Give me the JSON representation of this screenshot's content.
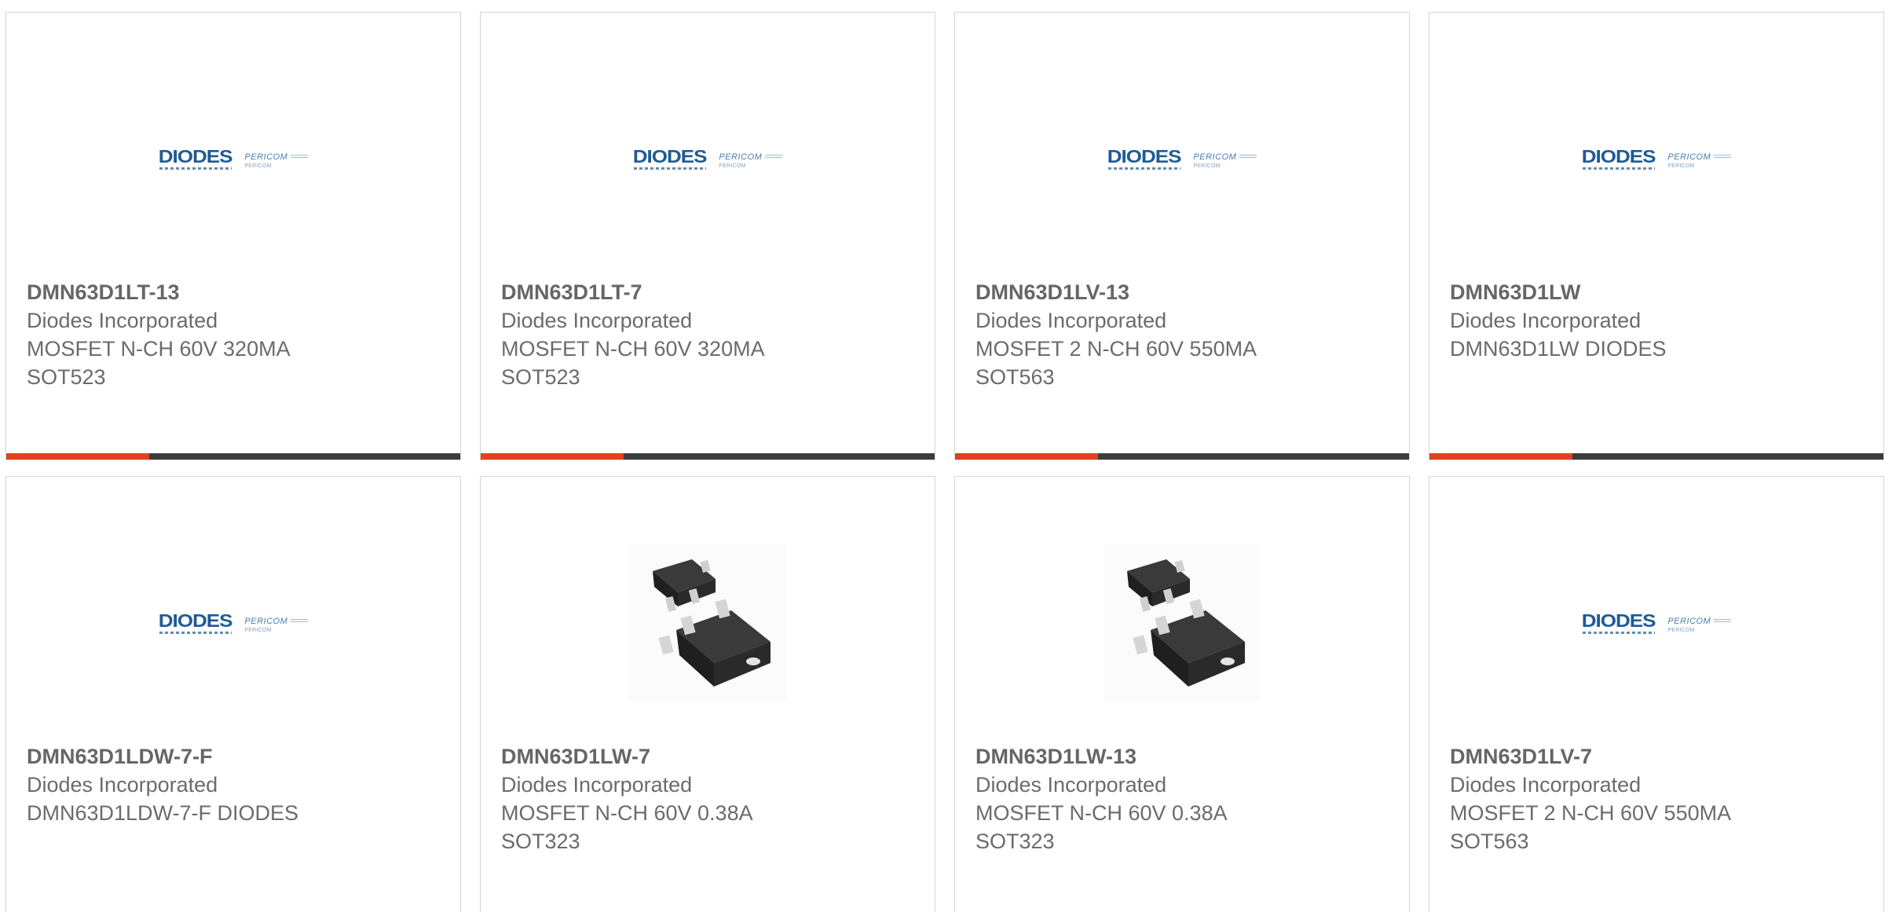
{
  "colors": {
    "accent": "#e0421c",
    "bar": "#3c3c3c",
    "text": "#6b6b6b",
    "diodes_blue": "#1e5b96"
  },
  "logo": {
    "diodes": "DIODES",
    "pericom": "PERICOM",
    "pericom_tag": "PERICOM"
  },
  "products": [
    {
      "part": "DMN63D1LT-13",
      "manufacturer": "Diodes Incorporated",
      "desc1": "MOSFET N-CH 60V 320MA",
      "desc2": "SOT523",
      "image": "diodes-pericom-logo"
    },
    {
      "part": "DMN63D1LT-7",
      "manufacturer": "Diodes Incorporated",
      "desc1": "MOSFET N-CH 60V 320MA",
      "desc2": "SOT523",
      "image": "diodes-pericom-logo"
    },
    {
      "part": "DMN63D1LV-13",
      "manufacturer": "Diodes Incorporated",
      "desc1": "MOSFET 2 N-CH 60V 550MA",
      "desc2": "SOT563",
      "image": "diodes-pericom-logo"
    },
    {
      "part": "DMN63D1LW",
      "manufacturer": "Diodes Incorporated",
      "desc1": "DMN63D1LW DIODES",
      "desc2": "",
      "image": "diodes-pericom-logo"
    },
    {
      "part": "DMN63D1LDW-7-F",
      "manufacturer": "Diodes Incorporated",
      "desc1": "DMN63D1LDW-7-F DIODES",
      "desc2": "",
      "image": "diodes-pericom-logo"
    },
    {
      "part": "DMN63D1LW-7",
      "manufacturer": "Diodes Incorporated",
      "desc1": "MOSFET N-CH 60V 0.38A",
      "desc2": "SOT323",
      "image": "sot323-package-photo"
    },
    {
      "part": "DMN63D1LW-13",
      "manufacturer": "Diodes Incorporated",
      "desc1": "MOSFET N-CH 60V 0.38A",
      "desc2": "SOT323",
      "image": "sot323-package-photo"
    },
    {
      "part": "DMN63D1LV-7",
      "manufacturer": "Diodes Incorporated",
      "desc1": "MOSFET 2 N-CH 60V 550MA",
      "desc2": "SOT563",
      "image": "diodes-pericom-logo"
    }
  ]
}
